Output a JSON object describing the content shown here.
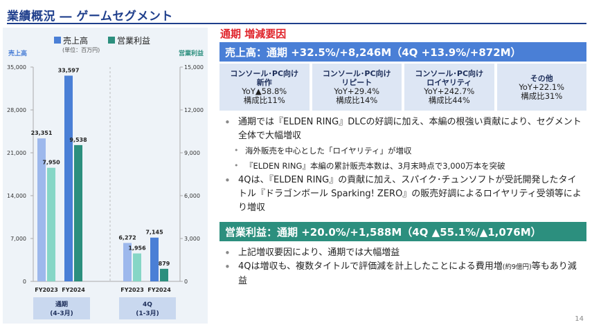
{
  "page": {
    "title": "業績概況 ― ゲームセグメント",
    "page_number": "14"
  },
  "chart_data": {
    "type": "bar",
    "legend": [
      "売上高",
      "営業利益"
    ],
    "legend_note": "(単位：百万円)",
    "left_axis_label": "売上高",
    "right_axis_label": "営業利益",
    "left_ticks": [
      "0",
      "7,000",
      "14,000",
      "21,000",
      "28,000",
      "35,000"
    ],
    "right_ticks": [
      "0",
      "3,000",
      "6,000",
      "9,000",
      "12,000",
      "15,000"
    ],
    "left_ylim": [
      0,
      35000
    ],
    "right_ylim": [
      0,
      15000
    ],
    "groups": [
      {
        "name_line1": "通期",
        "name_line2": "(4-3月)",
        "periods": [
          "FY2023",
          "FY2024"
        ],
        "sales": [
          23351,
          33597
        ],
        "sales_labels": [
          "23,351",
          "33,597"
        ],
        "profit": [
          7950,
          9538
        ],
        "profit_labels": [
          "7,950",
          "9,538"
        ]
      },
      {
        "name_line1": "4Q",
        "name_line2": "(1-3月)",
        "periods": [
          "FY2023",
          "FY2024"
        ],
        "sales": [
          6272,
          7145
        ],
        "sales_labels": [
          "6,272",
          "7,145"
        ],
        "profit": [
          1956,
          879
        ],
        "profit_labels": [
          "1,956",
          "879"
        ]
      }
    ],
    "colors": {
      "sales_prev": "#9db8ec",
      "sales_cur": "#4a7fd6",
      "profit_prev": "#86d6c6",
      "profit_cur": "#2c8f7e"
    }
  },
  "main": {
    "section_heading": "通期 増減要因",
    "sales_header": "売上高：通期 +32.5%/+8,246M（4Q +13.9%/+872M）",
    "segments": [
      {
        "line1": "コンソール･PC向け",
        "line2": "新作",
        "yoy": "YoY▲58.8%",
        "share": "構成比11%"
      },
      {
        "line1": "コンソール･PC向け",
        "line2": "リピート",
        "yoy": "YoY+29.4%",
        "share": "構成比14%"
      },
      {
        "line1": "コンソール･PC向け",
        "line2": "ロイヤリティ",
        "yoy": "YoY+242.7%",
        "share": "構成比44%"
      },
      {
        "line1": "その他",
        "line2": "",
        "yoy": "YoY+22.1%",
        "share": "構成比31%"
      }
    ],
    "sales_bullets": {
      "b1": "通期では『ELDEN RING』DLCの好調に加え、本編の根強い貢献により、セグメント全体で大幅増収",
      "s1": "海外販売を中心とした「ロイヤリティ」が増収",
      "s2": "『ELDEN RING』本編の累計販売本数は、3月末時点で3,000万本を突破",
      "b2": "4Qは、『ELDEN RING』の貢献に加え、スパイク･チュンソフトが受託開発したタイトル『ドラゴンボール Sparking! ZERO』の販売好調によるロイヤリティ受領等により増収"
    },
    "profit_header": "営業利益：通期 +20.0%/+1,588M（4Q ▲55.1%/▲1,076M）",
    "profit_bullets": {
      "b1": "上記増収要因により、通期では大幅増益",
      "b2_pre": "4Qは増収も、複数タイトルで評価減を計上したことによる費用増",
      "b2_small": "(約9億円)",
      "b2_post": "等もあり減益"
    }
  }
}
